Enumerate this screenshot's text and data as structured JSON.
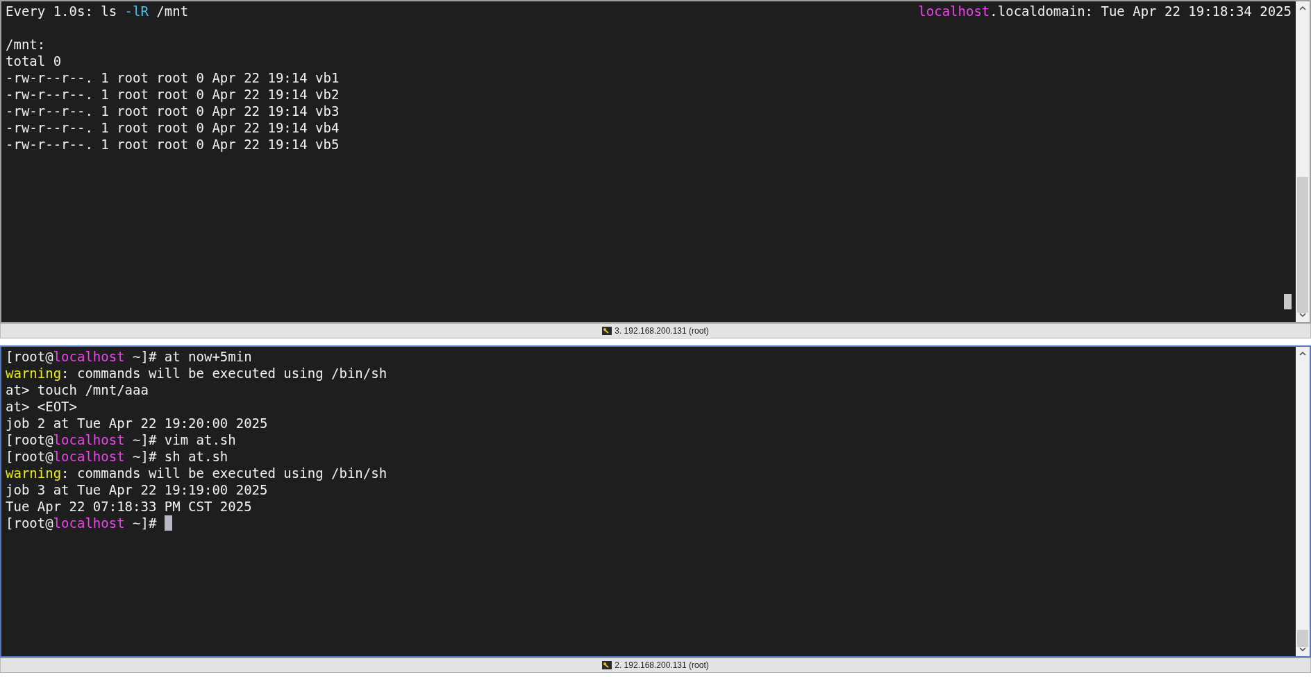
{
  "panes": [
    {
      "header": {
        "left": [
          {
            "kind": "plain",
            "text": "Every 1.0s: ls "
          },
          {
            "kind": "option",
            "text": "-lR"
          },
          {
            "kind": "plain",
            "text": " /mnt"
          }
        ],
        "right": [
          {
            "kind": "host",
            "text": "localhost"
          },
          {
            "kind": "plain",
            "text": ".localdomain: Tue Apr 22 19:18:34 2025"
          }
        ]
      },
      "lines": [
        {
          "cursor": false,
          "segments": [
            {
              "kind": "plain",
              "text": "/mnt:"
            }
          ]
        },
        {
          "cursor": false,
          "segments": [
            {
              "kind": "plain",
              "text": "total 0"
            }
          ]
        },
        {
          "cursor": false,
          "segments": [
            {
              "kind": "plain",
              "text": "-rw-r--r--. 1 root root 0 Apr 22 19:14 vb1"
            }
          ]
        },
        {
          "cursor": false,
          "segments": [
            {
              "kind": "plain",
              "text": "-rw-r--r--. 1 root root 0 Apr 22 19:14 vb2"
            }
          ]
        },
        {
          "cursor": false,
          "segments": [
            {
              "kind": "plain",
              "text": "-rw-r--r--. 1 root root 0 Apr 22 19:14 vb3"
            }
          ]
        },
        {
          "cursor": false,
          "segments": [
            {
              "kind": "plain",
              "text": "-rw-r--r--. 1 root root 0 Apr 22 19:14 vb4"
            }
          ]
        },
        {
          "cursor": false,
          "segments": [
            {
              "kind": "plain",
              "text": "-rw-r--r--. 1 root root 0 Apr 22 19:14 vb5"
            }
          ]
        }
      ],
      "status": "3. 192.168.200.131 (root)",
      "active": false
    },
    {
      "lines": [
        {
          "cursor": false,
          "segments": [
            {
              "kind": "plain",
              "text": "[root@"
            },
            {
              "kind": "host",
              "text": "localhost"
            },
            {
              "kind": "plain",
              "text": " ~]# at now+5min"
            }
          ]
        },
        {
          "cursor": false,
          "segments": [
            {
              "kind": "warning",
              "text": "warning"
            },
            {
              "kind": "plain",
              "text": ": commands will be executed using /bin/sh"
            }
          ]
        },
        {
          "cursor": false,
          "segments": [
            {
              "kind": "plain",
              "text": "at> touch /mnt/aaa"
            }
          ]
        },
        {
          "cursor": false,
          "segments": [
            {
              "kind": "plain",
              "text": "at> <EOT>"
            }
          ]
        },
        {
          "cursor": false,
          "segments": [
            {
              "kind": "plain",
              "text": "job 2 at Tue Apr 22 19:20:00 2025"
            }
          ]
        },
        {
          "cursor": false,
          "segments": [
            {
              "kind": "plain",
              "text": "[root@"
            },
            {
              "kind": "host",
              "text": "localhost"
            },
            {
              "kind": "plain",
              "text": " ~]# vim at.sh"
            }
          ]
        },
        {
          "cursor": false,
          "segments": [
            {
              "kind": "plain",
              "text": "[root@"
            },
            {
              "kind": "host",
              "text": "localhost"
            },
            {
              "kind": "plain",
              "text": " ~]# sh at.sh"
            }
          ]
        },
        {
          "cursor": false,
          "segments": [
            {
              "kind": "warning",
              "text": "warning"
            },
            {
              "kind": "plain",
              "text": ": commands will be executed using /bin/sh"
            }
          ]
        },
        {
          "cursor": false,
          "segments": [
            {
              "kind": "plain",
              "text": "job 3 at Tue Apr 22 19:19:00 2025"
            }
          ]
        },
        {
          "cursor": false,
          "segments": [
            {
              "kind": "plain",
              "text": "Tue Apr 22 07:18:33 PM CST 2025"
            }
          ]
        },
        {
          "cursor": true,
          "segments": [
            {
              "kind": "plain",
              "text": "[root@"
            },
            {
              "kind": "host",
              "text": "localhost"
            },
            {
              "kind": "plain",
              "text": " ~]# "
            }
          ]
        }
      ],
      "status": "2. 192.168.200.131 (root)",
      "active": true
    }
  ]
}
